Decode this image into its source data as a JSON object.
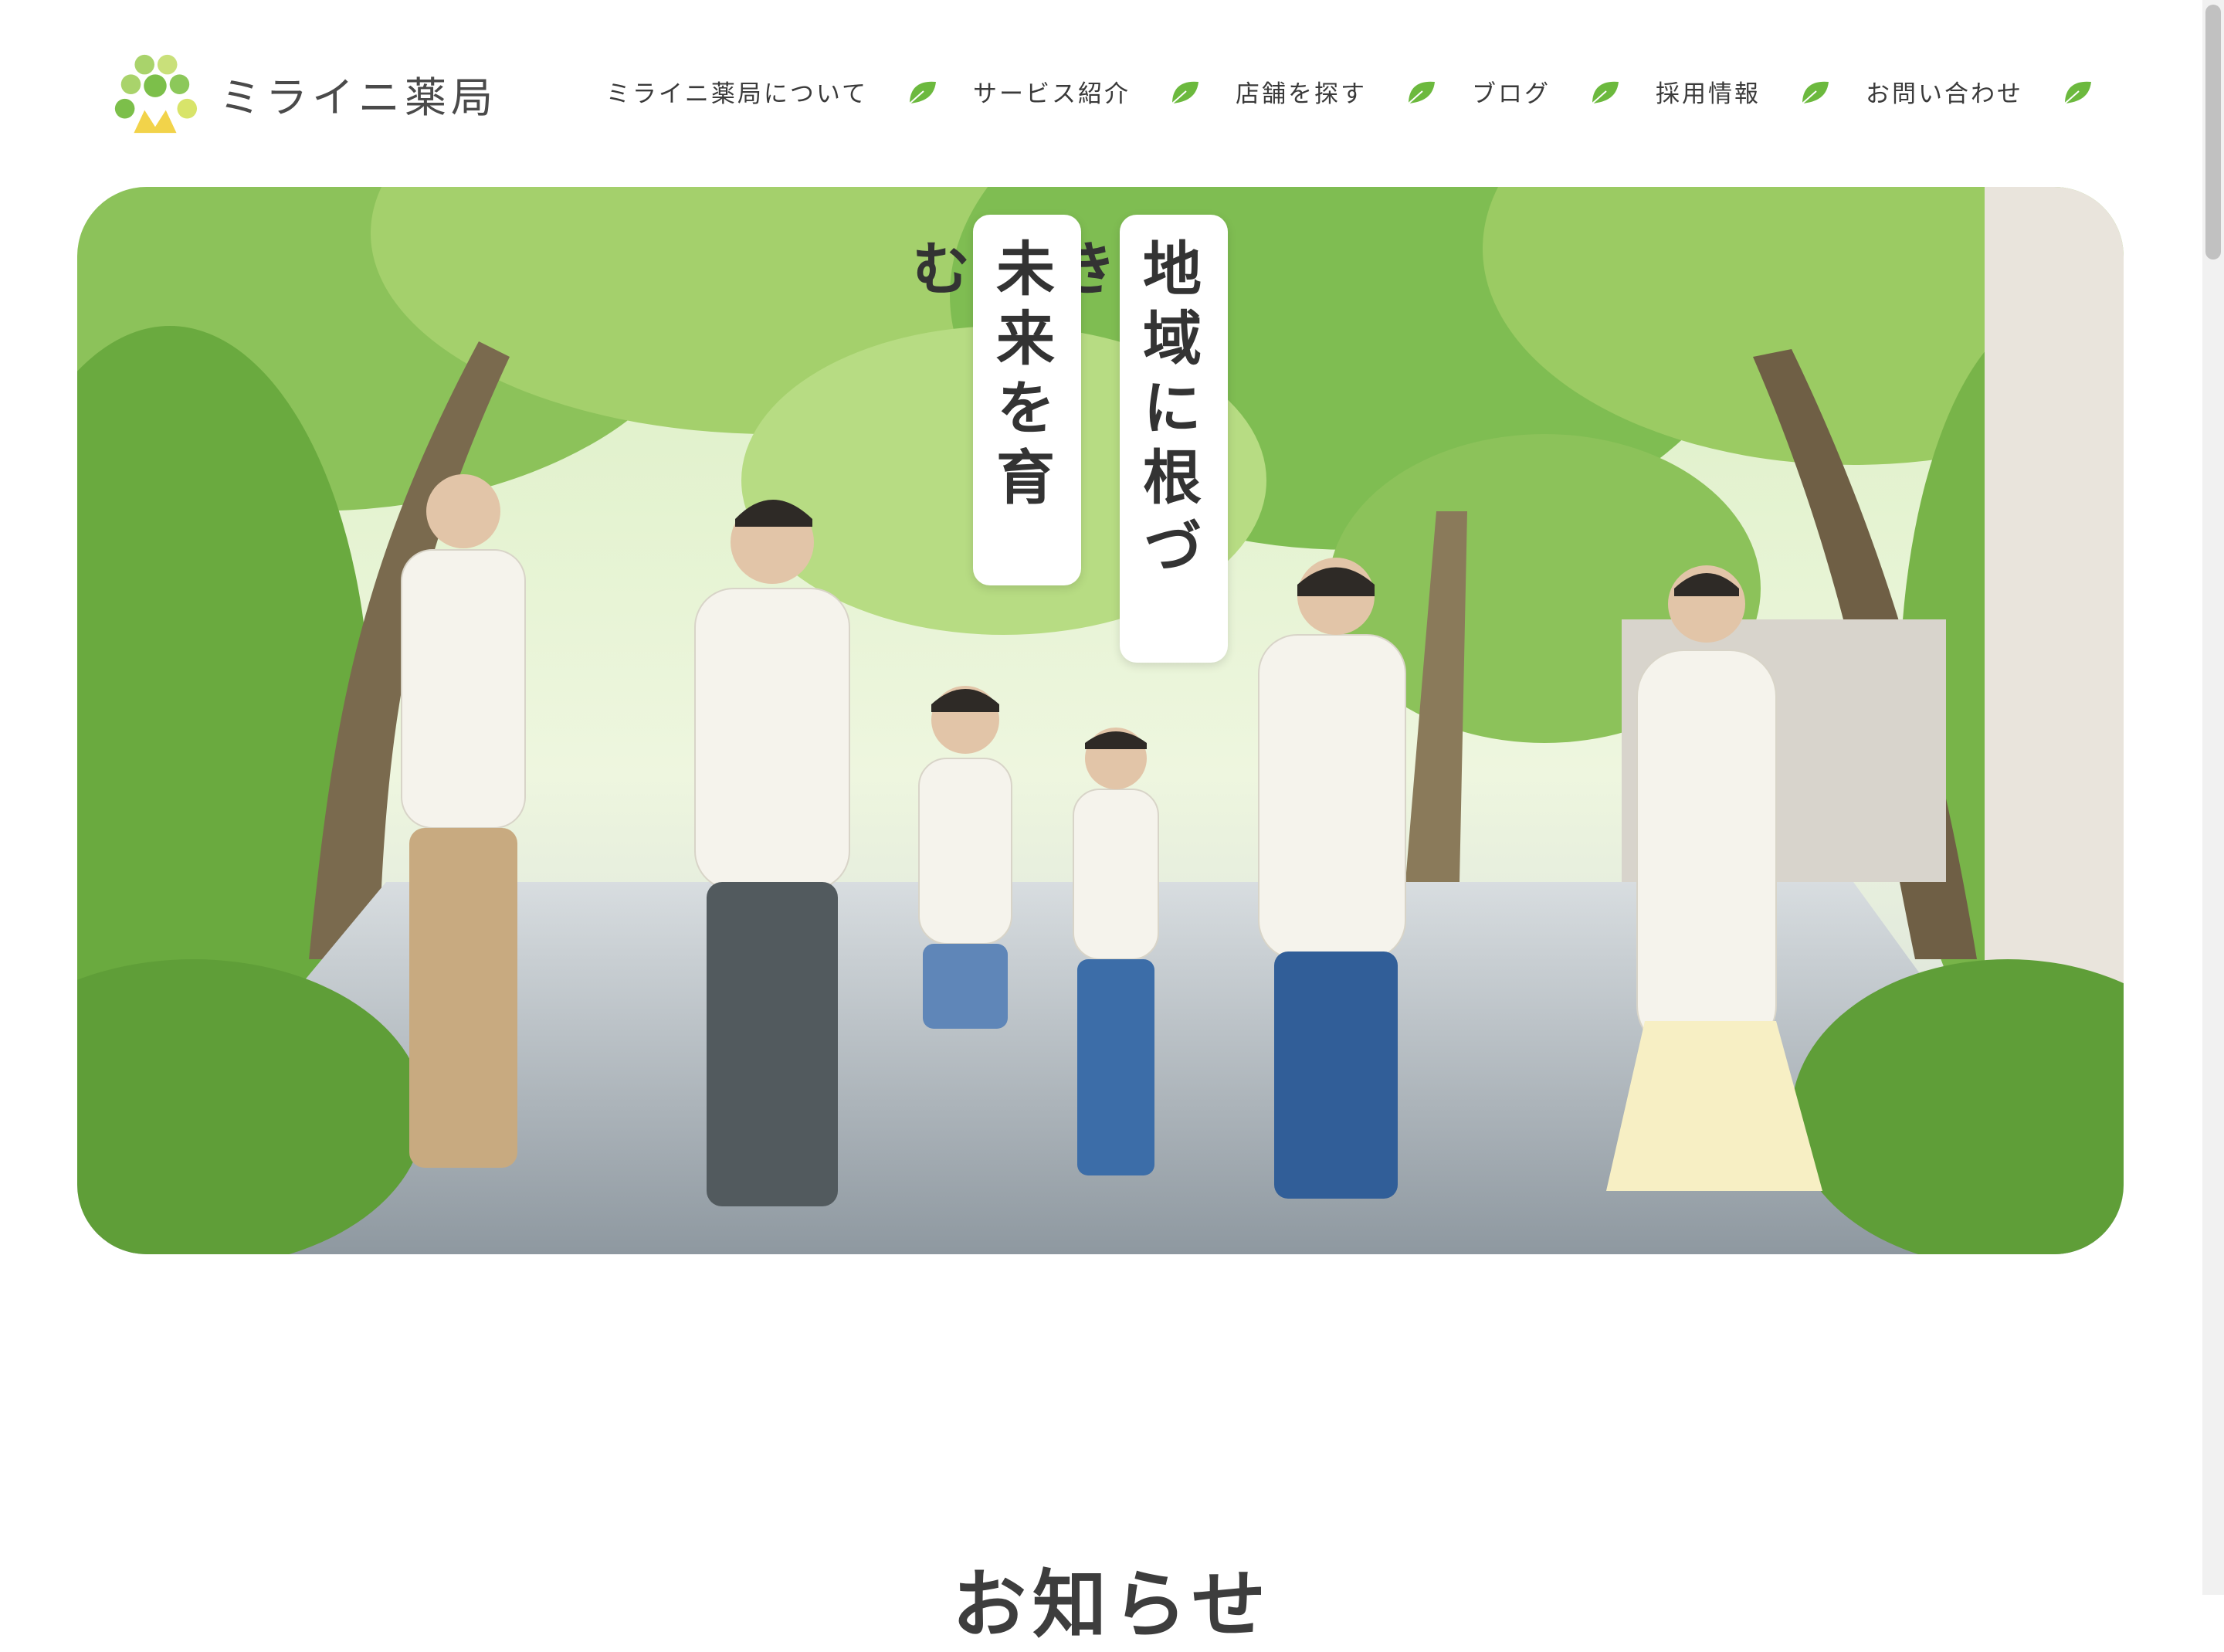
{
  "header": {
    "logo_text": "ミライニ薬局",
    "nav": [
      {
        "label": "ミライニ薬局について"
      },
      {
        "label": "サービス紹介"
      },
      {
        "label": "店舗を探す"
      },
      {
        "label": "ブログ"
      },
      {
        "label": "採用情報"
      },
      {
        "label": "お問い合わせ"
      }
    ]
  },
  "hero": {
    "tagline_1": "地域に根づき",
    "tagline_2": "未来を育む"
  },
  "news": {
    "title": "お知らせ"
  },
  "colors": {
    "accent_green": "#6cb93e",
    "logo_green_light": "#b7d86a",
    "logo_yellow": "#f2d34a",
    "text": "#3d3d3d"
  }
}
